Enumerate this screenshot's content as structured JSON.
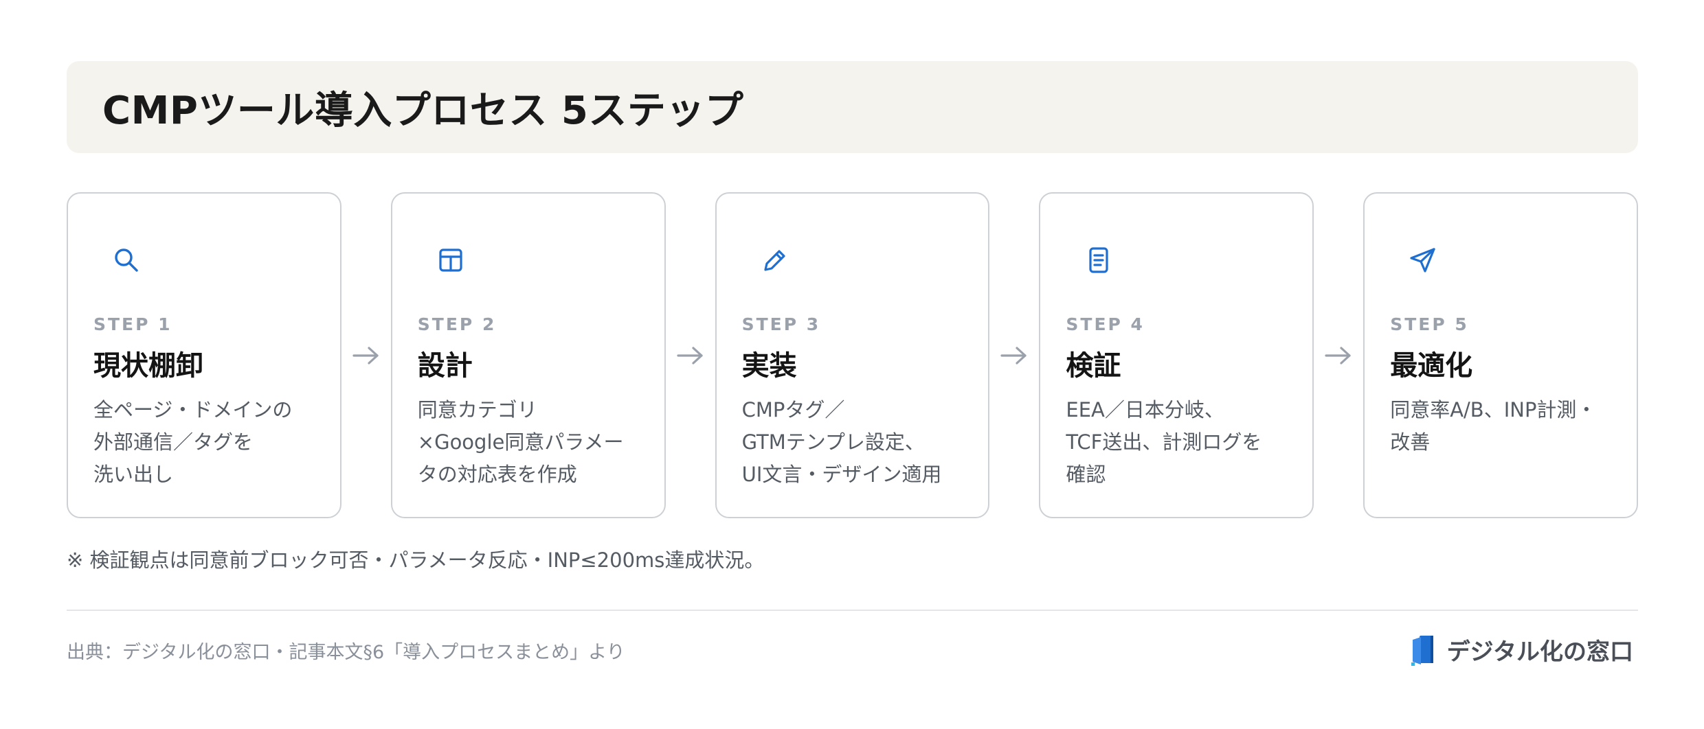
{
  "title": "CMPツール導入プロセス 5ステップ",
  "colors": {
    "accent": "#1f6fd1",
    "arrow": "#9aa1ab",
    "title_bg": "#f5f3ee"
  },
  "steps": [
    {
      "label": "STEP 1",
      "title": "現状棚卸",
      "icon": "search-icon",
      "desc": [
        "全ページ・ドメインの",
        "外部通信／タグを",
        "洗い出し"
      ]
    },
    {
      "label": "STEP 2",
      "title": "設計",
      "icon": "table-icon",
      "desc": [
        "同意カテゴリ",
        "×Google同意パラメー",
        "タの対応表を作成"
      ]
    },
    {
      "label": "STEP 3",
      "title": "実装",
      "icon": "pencil-icon",
      "desc": [
        "CMPタグ／",
        "GTMテンプレ設定、",
        "UI文言・デザイン適用"
      ]
    },
    {
      "label": "STEP 4",
      "title": "検証",
      "icon": "document-icon",
      "desc": [
        "EEA／日本分岐、",
        "TCF送出、計測ログを",
        "確認"
      ]
    },
    {
      "label": "STEP 5",
      "title": "最適化",
      "icon": "send-icon",
      "desc": [
        "同意率A/B、INP計測・",
        "改善"
      ]
    }
  ],
  "note": "※ 検証観点は同意前ブロック可否・パラメータ反応・INP≤200ms達成状況。",
  "source": "出典：デジタル化の窓口・記事本文§6「導入プロセスまとめ」より",
  "brand": {
    "name": "デジタル化の窓口",
    "logo": "window-logo-icon"
  }
}
